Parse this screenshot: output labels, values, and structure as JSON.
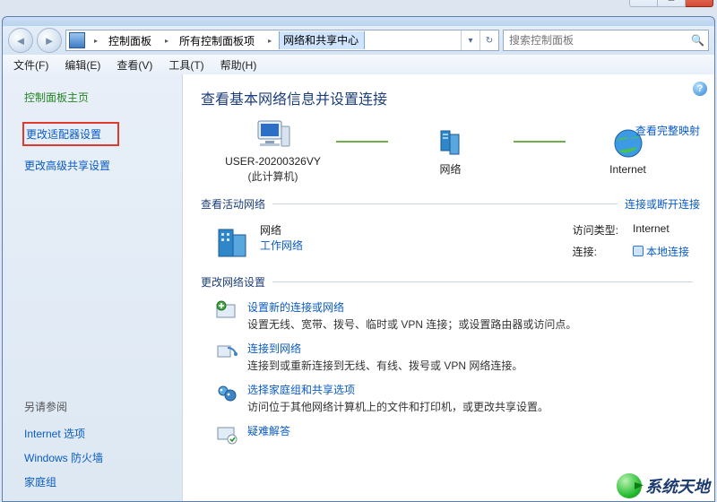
{
  "window": {
    "min": "—",
    "max": "◻",
    "close": "✕"
  },
  "nav": {
    "back": "◄",
    "forward": "►"
  },
  "breadcrumb": {
    "seg1": "控制面板",
    "seg2": "所有控制面板项",
    "seg3": "网络和共享中心",
    "chev": "▸",
    "dropdown": "▾",
    "refresh": "↻"
  },
  "search": {
    "placeholder": "搜索控制面板",
    "icon": "🔍"
  },
  "menu": {
    "file": "文件(F)",
    "edit": "编辑(E)",
    "view": "查看(V)",
    "tools": "工具(T)",
    "help": "帮助(H)"
  },
  "sidebar": {
    "home": "控制面板主页",
    "adapter": "更改适配器设置",
    "advshare": "更改高级共享设置",
    "seealso": "另请参阅",
    "inetopt": "Internet 选项",
    "firewall": "Windows 防火墙",
    "homegroup": "家庭组"
  },
  "main": {
    "heading": "查看基本网络信息并设置连接",
    "fullmap": "查看完整映射",
    "node_pc": "USER-20200326VY",
    "node_pc_sub": "(此计算机)",
    "node_net": "网络",
    "node_inet": "Internet",
    "active_title": "查看活动网络",
    "active_link": "连接或断开连接",
    "anet_name": "网络",
    "anet_cat": "工作网络",
    "prop_access_k": "访问类型:",
    "prop_access_v": "Internet",
    "prop_conn_k": "连接:",
    "prop_conn_v": "本地连接",
    "change_title": "更改网络设置",
    "tasks": [
      {
        "title": "设置新的连接或网络",
        "desc": "设置无线、宽带、拨号、临时或 VPN 连接；或设置路由器或访问点。"
      },
      {
        "title": "连接到网络",
        "desc": "连接到或重新连接到无线、有线、拨号或 VPN 网络连接。"
      },
      {
        "title": "选择家庭组和共享选项",
        "desc": "访问位于其他网络计算机上的文件和打印机，或更改共享设置。"
      },
      {
        "title": "疑难解答",
        "desc": ""
      }
    ]
  },
  "brand": "系统天地"
}
